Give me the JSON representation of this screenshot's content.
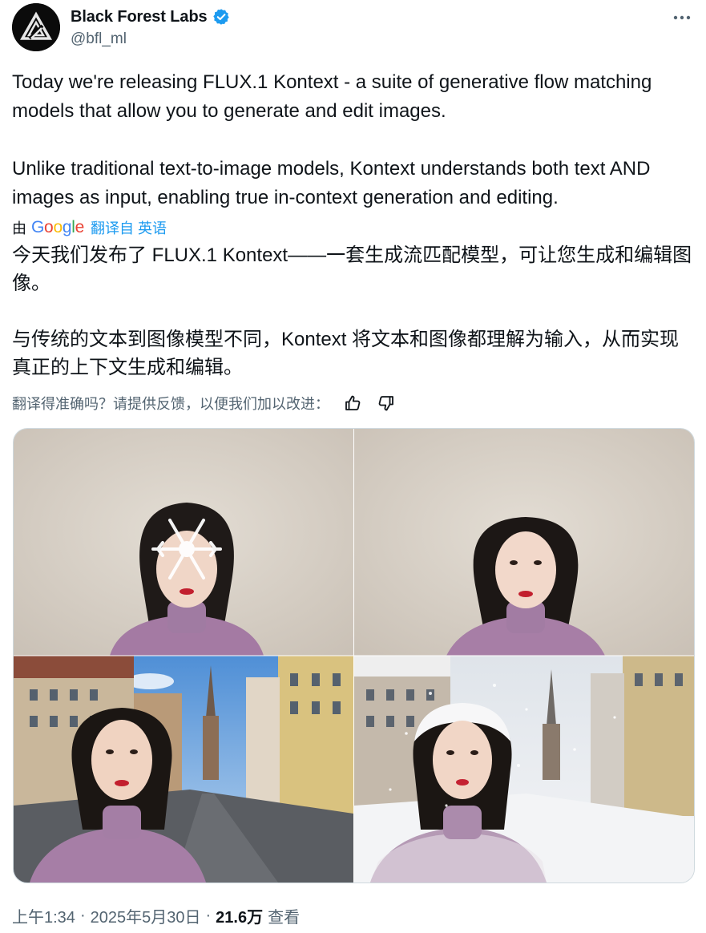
{
  "author": {
    "display_name": "Black Forest Labs",
    "handle": "@bfl_ml",
    "avatar_icon": "bfl-logo-icon",
    "verified_icon": "verified-badge-icon",
    "verified_color": "#1d9bf0"
  },
  "more_icon": "more-options-icon",
  "tweet": {
    "text": "Today we're releasing FLUX.1 Kontext - a suite of generative flow matching models that allow you to generate and edit images.\n\nUnlike traditional text-to-image models, Kontext understands both text AND images as input, enabling true in-context generation and editing."
  },
  "translation": {
    "by_label": "由",
    "provider": "Google",
    "from_label": "翻译自 英语",
    "text": "今天我们发布了 FLUX.1 Kontext——一套生成流匹配模型，可让您生成和编辑图像。\n\n与传统的文本到图像模型不同，Kontext 将文本和图像都理解为输入，从而实现真正的上下文生成和编辑。",
    "feedback_prompt": "翻译得准确吗？请提供反馈，以便我们加以改进：",
    "thumbs_up_icon": "thumbs-up-icon",
    "thumbs_down_icon": "thumbs-down-icon"
  },
  "media": {
    "images": [
      {
        "name": "snowflake-portrait-image",
        "icon": "portrait-with-snowflake"
      },
      {
        "name": "plain-portrait-image",
        "icon": "portrait-plain"
      },
      {
        "name": "street-portrait-image",
        "icon": "portrait-street"
      },
      {
        "name": "snowy-street-portrait-image",
        "icon": "portrait-snowy-street"
      }
    ]
  },
  "meta": {
    "time": "上午1:34",
    "date": "2025年5月30日",
    "views_count": "21.6万",
    "views_label": "查看",
    "separator": "·"
  },
  "colors": {
    "text_primary": "#0f1419",
    "text_secondary": "#536471",
    "link": "#1d9bf0",
    "border": "#cfd9de"
  }
}
